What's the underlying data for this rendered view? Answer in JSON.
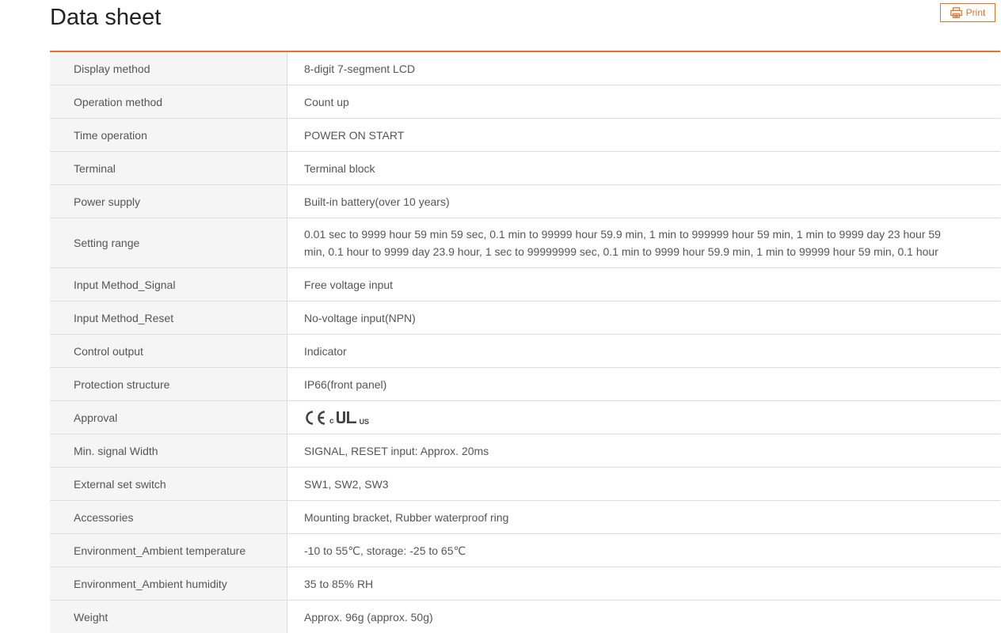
{
  "header": {
    "title": "Data sheet",
    "print_label": "Print"
  },
  "specs": [
    {
      "label": "Display method",
      "value": "8-digit 7-segment LCD"
    },
    {
      "label": "Operation method",
      "value": "Count up"
    },
    {
      "label": "Time operation",
      "value": "POWER ON START"
    },
    {
      "label": "Terminal",
      "value": "Terminal block"
    },
    {
      "label": "Power supply",
      "value": "Built-in battery(over 10 years)"
    },
    {
      "label": "Setting range",
      "value": "0.01 sec to 9999 hour 59 min 59 sec, 0.1 min to 99999 hour 59.9 min, 1 min to 999999 hour 59 min, 1 min to 9999 day 23 hour 59 min, 0.1 hour to 9999 day 23.9 hour, 1 sec to 99999999 sec, 0.1 min to 9999 hour 59.9 min, 1 min to 99999 hour 59 min, 0.1 hour"
    },
    {
      "label": "Input Method_Signal",
      "value": "Free voltage input"
    },
    {
      "label": "Input Method_Reset",
      "value": "No-voltage input(NPN)"
    },
    {
      "label": "Control output",
      "value": "Indicator"
    },
    {
      "label": "Protection structure",
      "value": "IP66(front panel)"
    },
    {
      "label": "Approval",
      "logos": [
        "ce-mark-icon",
        "cul-us-mark-icon"
      ],
      "ul_prefix": "c",
      "ul_suffix": "US"
    },
    {
      "label": "Min. signal Width",
      "value": "SIGNAL, RESET input: Approx. 20ms"
    },
    {
      "label": "External set switch",
      "value": "SW1, SW2, SW3"
    },
    {
      "label": "Accessories",
      "value": "Mounting bracket, Rubber waterproof ring"
    },
    {
      "label": "Environment_Ambient temperature",
      "value": "-10 to 55℃, storage: -25 to 65℃"
    },
    {
      "label": "Environment_Ambient humidity",
      "value": "35 to 85% RH"
    },
    {
      "label": "Weight",
      "value": "Approx. 96g (approx. 50g)"
    }
  ],
  "colors": {
    "accent": "#e8702a",
    "label_background": "#f5f5f5",
    "border": "#dddddd",
    "text": "#555555"
  }
}
